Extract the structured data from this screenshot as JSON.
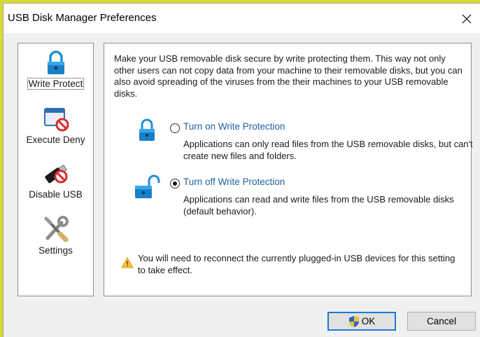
{
  "window": {
    "title": "USB Disk Manager Preferences",
    "close_icon": "close-icon"
  },
  "sidebar": {
    "items": [
      {
        "label": "Write Protect",
        "icon": "padlock-icon",
        "selected": true
      },
      {
        "label": "Execute Deny",
        "icon": "window-deny-icon",
        "selected": false
      },
      {
        "label": "Disable USB",
        "icon": "usb-deny-icon",
        "selected": false
      },
      {
        "label": "Settings",
        "icon": "tools-icon",
        "selected": false
      }
    ]
  },
  "content": {
    "description": "Make your USB removable disk secure by write protecting them. This way not only other users can not copy data from your machine to their removable disks, but you can also avoid spreading of the viruses from the their machines to your USB removable disks.",
    "options": [
      {
        "label": "Turn on Write Protection",
        "description": "Applications can only read files from the USB removable disks, but can't create new files and folders.",
        "checked": false,
        "icon": "lock-closed-icon"
      },
      {
        "label": "Turn off Write Protection",
        "description": "Applications can read and write files from the USB removable disks (default behavior).",
        "checked": true,
        "icon": "lock-open-icon"
      }
    ],
    "warning": "You will need to reconnect the currently plugged-in USB devices for this setting to take effect."
  },
  "buttons": {
    "ok": "OK",
    "cancel": "Cancel"
  },
  "colors": {
    "accent": "#1e78d6",
    "link": "#1f5fa6",
    "background": "#d6dc2e"
  }
}
